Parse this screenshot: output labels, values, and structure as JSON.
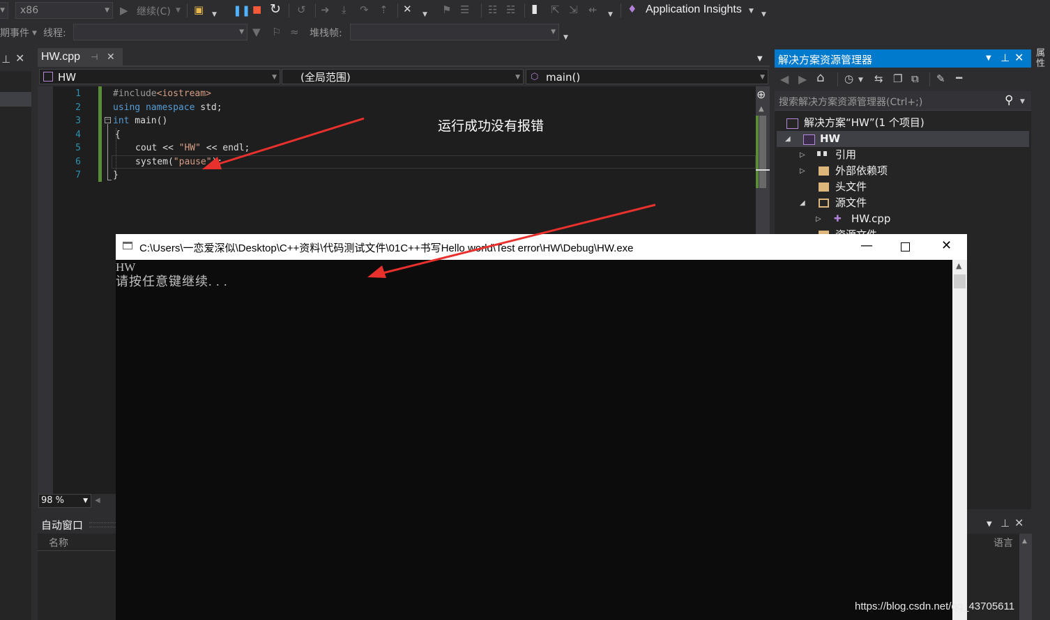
{
  "toolbar1": {
    "platform": "x86",
    "continue_label": "继续(C)",
    "app_insights": "Application Insights"
  },
  "toolbar2": {
    "events_label": "期事件",
    "thread_label": "线程:",
    "stackframe_label": "堆栈帧:"
  },
  "editor": {
    "tab_name": "HW.cpp",
    "nav_project": "HW",
    "nav_scope": "(全局范围)",
    "nav_function": "main()",
    "line_numbers": [
      "1",
      "2",
      "3",
      "4",
      "5",
      "6",
      "7"
    ],
    "code": {
      "l1_pp": "#include",
      "l1_inc": "<iostream>",
      "l2_kw1": "using",
      "l2_kw2": "namespace",
      "l2_rest": " std;",
      "l3_kw": "int",
      "l3_rest": " main()",
      "l4": "{",
      "l5_a": "cout << ",
      "l5_str": "\"HW\"",
      "l5_b": " << endl;",
      "l6_a": "system(",
      "l6_str": "\"pause\"",
      "l6_b": ");",
      "l7": "}"
    },
    "zoom": "98 %",
    "annotation": "运行成功没有报错"
  },
  "auto_window": {
    "title": "自动窗口",
    "col_name": "名称",
    "col_lang": "语言"
  },
  "solution_explorer": {
    "title": "解决方案资源管理器",
    "search_placeholder": "搜索解决方案资源管理器(Ctrl+;)",
    "solution": "解决方案“HW”(1 个项目)",
    "project": "HW",
    "references": "引用",
    "external_deps": "外部依赖项",
    "headers": "头文件",
    "sources": "源文件",
    "source_file": "HW.cpp",
    "resources": "资源文件"
  },
  "right_strip": {
    "properties": "属性"
  },
  "console": {
    "title": "C:\\Users\\一恋爱深似\\Desktop\\C++资料\\代码测试文件\\01C++书写Hello world\\Test error\\HW\\Debug\\HW.exe",
    "output_line1": "HW",
    "output_line2": "请按任意键继续. . ."
  },
  "watermark": "https://blog.csdn.net/qq_43705611",
  "colors": {
    "vs_bg": "#2d2d30",
    "editor_bg": "#1e1e1e",
    "accent": "#007acc",
    "console_bg": "#0c0c0c",
    "arrow": "#e8302c"
  }
}
